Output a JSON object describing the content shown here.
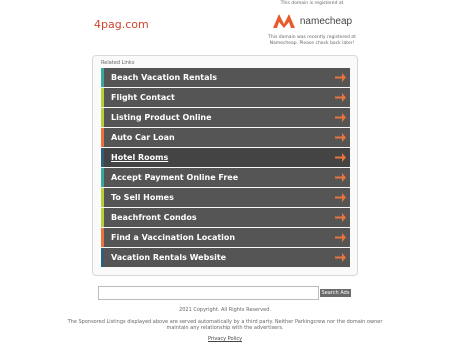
{
  "header": {
    "domain": "4pag.com"
  },
  "registrar": {
    "note": "This domain is registered at",
    "brand": "namecheap",
    "sub_note": "This domain was recently registered at Namecheap. Please check back later!"
  },
  "related": {
    "heading": "Related Links",
    "links": [
      {
        "label": "Beach Vacation Rentals",
        "color": "#3aa7a0"
      },
      {
        "label": "Flight Contact",
        "color": "#b7cf3a"
      },
      {
        "label": "Listing Product Online",
        "color": "#b7cf3a"
      },
      {
        "label": "Auto Car Loan",
        "color": "#e8743b"
      },
      {
        "label": "Hotel Rooms",
        "color": "#2f5d7a"
      },
      {
        "label": "Accept Payment Online Free",
        "color": "#3aa7a0"
      },
      {
        "label": "To Sell Homes",
        "color": "#b7cf3a"
      },
      {
        "label": "Beachfront Condos",
        "color": "#b7cf3a"
      },
      {
        "label": "Find a Vaccination Location",
        "color": "#e8743b"
      },
      {
        "label": "Vacation Rentals Website",
        "color": "#2f5d7a"
      }
    ],
    "arrow_color": "#e8743b"
  },
  "search": {
    "value": "",
    "button_label": "Search Ads"
  },
  "footer": {
    "copyright": "2021 Copyright. All Rights Reserved.",
    "disclaimer": "The Sponsored Listings displayed above are served automatically by a third party. Neither Parkingcrew nor the domain owner maintain any relationship with the advertisers.",
    "privacy": "Privacy Policy"
  }
}
